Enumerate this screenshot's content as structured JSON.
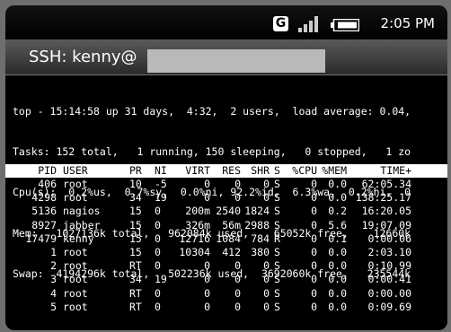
{
  "status_bar": {
    "carrier_badge": "G",
    "time": "2:05 PM",
    "icons": [
      "signal-icon",
      "battery-icon"
    ]
  },
  "title_bar": {
    "title": "SSH: kenny@"
  },
  "top_summary": [
    "top - 15:14:58 up 31 days,  4:32,  2 users,  load average: 0.04,",
    "Tasks: 152 total,   1 running, 150 sleeping,   0 stopped,   1 zo",
    "Cpu(s):  0.2%us,  0.7%sy,  0.0%ni, 92.2%id,  6.3%wa,  0.2%hi,  0",
    "Mem:   1027136k total,   962084k used,    65052k free,    12660k",
    "Swap:  4194296k total,   502236k used,  3692060k free,   235544k"
  ],
  "process_table": {
    "columns": [
      "PID",
      "USER",
      "PR",
      "NI",
      "VIRT",
      "RES",
      "SHR",
      "S",
      "%CPU",
      "%MEM",
      "TIME+"
    ],
    "rows": [
      [
        "406",
        "root",
        "10",
        "-5",
        "0",
        "0",
        "0",
        "S",
        "0",
        "0.0",
        "62:05.34"
      ],
      [
        "4298",
        "root",
        "34",
        "19",
        "0",
        "0",
        "0",
        "S",
        "0",
        "0.0",
        "138:25.17"
      ],
      [
        "5136",
        "nagios",
        "15",
        "0",
        "200m",
        "2540",
        "1824",
        "S",
        "0",
        "0.2",
        "16:20.05"
      ],
      [
        "8927",
        "jabber",
        "15",
        "0",
        "326m",
        "56m",
        "2988",
        "S",
        "0",
        "5.6",
        "19:07.09"
      ],
      [
        "17479",
        "kenny",
        "15",
        "0",
        "12716",
        "1084",
        "784",
        "R",
        "0",
        "0.1",
        "0:00.06"
      ],
      [
        "1",
        "root",
        "15",
        "0",
        "10304",
        "412",
        "380",
        "S",
        "0",
        "0.0",
        "2:03.10"
      ],
      [
        "2",
        "root",
        "RT",
        "0",
        "0",
        "0",
        "0",
        "S",
        "0",
        "0.0",
        "0:10.99"
      ],
      [
        "3",
        "root",
        "34",
        "19",
        "0",
        "0",
        "0",
        "S",
        "0",
        "0.0",
        "0:00.41"
      ],
      [
        "4",
        "root",
        "RT",
        "0",
        "0",
        "0",
        "0",
        "S",
        "0",
        "0.0",
        "0:00.00"
      ],
      [
        "5",
        "root",
        "RT",
        "0",
        "0",
        "0",
        "0",
        "S",
        "0",
        "0.0",
        "0:09.69"
      ]
    ]
  }
}
